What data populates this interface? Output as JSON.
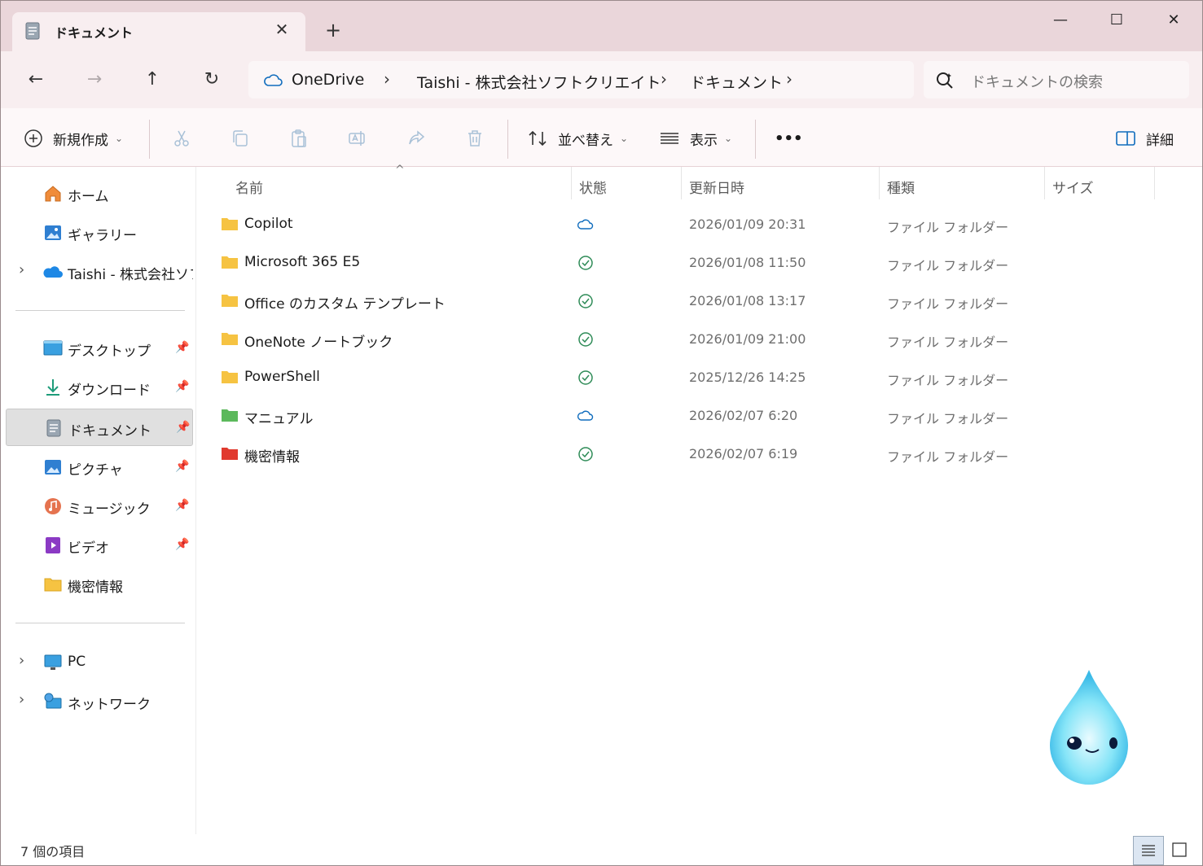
{
  "window": {
    "tab_title": "ドキュメント",
    "new_tab": "+",
    "minimize": "—",
    "maximize": "☐",
    "close": "✕"
  },
  "address": {
    "crumbs": [
      "OneDrive",
      "Taishi - 株式会社ソフトクリエイト",
      "ドキュメント"
    ],
    "search_placeholder": "ドキュメントの検索"
  },
  "toolbar": {
    "new_label": "新規作成",
    "sort_label": "並べ替え",
    "view_label": "表示",
    "more_label": "•••",
    "details_label": "詳細"
  },
  "sidebar": {
    "top_items": [
      {
        "label": "ホーム",
        "icon": "home-icon"
      },
      {
        "label": "ギャラリー",
        "icon": "gallery-icon"
      },
      {
        "label": "Taishi - 株式会社ソフトクリエイト",
        "icon": "onedrive-icon"
      }
    ],
    "pinned_items": [
      {
        "label": "デスクトップ",
        "icon": "desktop-icon"
      },
      {
        "label": "ダウンロード",
        "icon": "download-icon"
      },
      {
        "label": "ドキュメント",
        "icon": "document-icon"
      },
      {
        "label": "ピクチャ",
        "icon": "pictures-icon"
      },
      {
        "label": "ミュージック",
        "icon": "music-icon"
      },
      {
        "label": "ビデオ",
        "icon": "video-icon"
      },
      {
        "label": "機密情報",
        "icon": "folder-icon"
      }
    ],
    "bottom_items": [
      {
        "label": "PC",
        "icon": "pc-icon"
      },
      {
        "label": "ネットワーク",
        "icon": "network-icon"
      }
    ]
  },
  "columns": {
    "name": "名前",
    "status": "状態",
    "modified": "更新日時",
    "type": "種類",
    "size": "サイズ"
  },
  "files": [
    {
      "name": "Copilot",
      "status": "cloud",
      "date": "2026/01/09 20:31",
      "type": "ファイル フォルダー",
      "color": "#f6c342"
    },
    {
      "name": "Microsoft 365 E5",
      "status": "synced",
      "date": "2026/01/08 11:50",
      "type": "ファイル フォルダー",
      "color": "#f6c342"
    },
    {
      "name": "Office のカスタム テンプレート",
      "status": "synced",
      "date": "2026/01/08 13:17",
      "type": "ファイル フォルダー",
      "color": "#f6c342"
    },
    {
      "name": "OneNote ノートブック",
      "status": "synced",
      "date": "2026/01/09 21:00",
      "type": "ファイル フォルダー",
      "color": "#f6c342"
    },
    {
      "name": "PowerShell",
      "status": "synced",
      "date": "2025/12/26 14:25",
      "type": "ファイル フォルダー",
      "color": "#f6c342"
    },
    {
      "name": "マニュアル",
      "status": "cloud",
      "date": "2026/02/07 6:20",
      "type": "ファイル フォルダー",
      "color": "#5cb85c"
    },
    {
      "name": "機密情報",
      "status": "synced",
      "date": "2026/02/07 6:19",
      "type": "ファイル フォルダー",
      "color": "#e03a2e"
    }
  ],
  "statusbar": {
    "item_count": "7 個の項目"
  },
  "colors": {
    "titlebar_bg": "#ead6da",
    "accent": "#0f6cbd",
    "synced": "#2e8b57"
  }
}
